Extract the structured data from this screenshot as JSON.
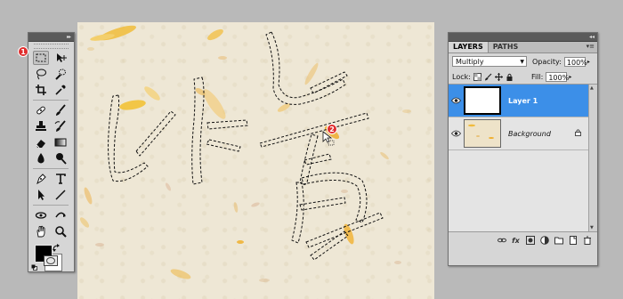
{
  "tools_panel": {
    "collapse_glyph": "▸▸",
    "tools": [
      {
        "name": "rectangular-marquee-tool",
        "active": true
      },
      {
        "name": "move-tool"
      },
      {
        "name": "lasso-tool"
      },
      {
        "name": "quick-selection-tool"
      },
      {
        "name": "crop-tool"
      },
      {
        "name": "eyedropper-tool"
      },
      {
        "name": "spot-healing-brush-tool"
      },
      {
        "name": "brush-tool"
      },
      {
        "name": "clone-stamp-tool"
      },
      {
        "name": "history-brush-tool"
      },
      {
        "name": "eraser-tool"
      },
      {
        "name": "gradient-tool"
      },
      {
        "name": "blur-tool"
      },
      {
        "name": "dodge-tool"
      },
      {
        "name": "pen-tool"
      },
      {
        "name": "type-tool"
      },
      {
        "name": "path-selection-tool"
      },
      {
        "name": "line-tool"
      },
      {
        "name": "3d-rotate-tool"
      },
      {
        "name": "3d-orbit-tool"
      },
      {
        "name": "hand-tool"
      },
      {
        "name": "zoom-tool"
      }
    ],
    "foreground_color": "#000000",
    "background_color": "#ffffff"
  },
  "callouts": {
    "one": "1",
    "two": "2"
  },
  "layers_panel": {
    "collapse_glyph": "◂◂",
    "tabs": [
      "LAYERS",
      "PATHS"
    ],
    "active_tab": "LAYERS",
    "blend_mode": "Multiply",
    "opacity_label": "Opacity:",
    "opacity_value": "100%",
    "lock_label": "Lock:",
    "fill_label": "Fill:",
    "fill_value": "100%",
    "layers": [
      {
        "name": "Layer 1",
        "selected": true,
        "visible": true
      },
      {
        "name": "Background",
        "selected": false,
        "visible": true,
        "locked": true
      }
    ]
  },
  "colors": {
    "selection_highlight": "#3c8fe8",
    "panel_bg": "#d6d6d6",
    "canvas_paper": "#eee7d5",
    "petal": "#f0b52a"
  }
}
